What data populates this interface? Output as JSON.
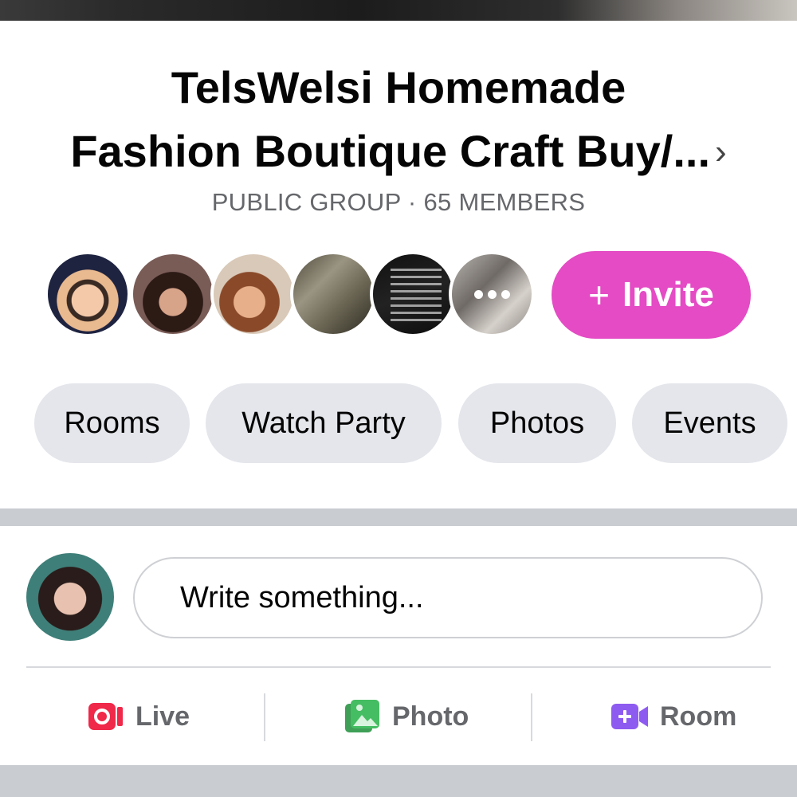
{
  "group": {
    "title_line1": "TelsWelsi Homemade",
    "title_line2": "Fashion  Boutique Craft Buy/...",
    "chevron": "›",
    "meta": "PUBLIC GROUP · 65 MEMBERS"
  },
  "members": {
    "avatars": [
      "member-avatar",
      "member-avatar",
      "member-avatar",
      "member-avatar",
      "member-avatar",
      "member-avatar-more"
    ],
    "more_icon": "more-dots-icon"
  },
  "invite": {
    "plus": "+",
    "label": "Invite",
    "color": "#e44bc4"
  },
  "tabs": [
    {
      "label": "Rooms"
    },
    {
      "label": "Watch Party"
    },
    {
      "label": "Photos"
    },
    {
      "label": "Events"
    }
  ],
  "composer": {
    "placeholder": "Write something..."
  },
  "actions": [
    {
      "label": "Live",
      "icon": "live-video-icon",
      "color": "#f02849"
    },
    {
      "label": "Photo",
      "icon": "photo-icon",
      "color": "#45bd62"
    },
    {
      "label": "Room",
      "icon": "room-video-icon",
      "color": "#8e5bf0"
    }
  ]
}
